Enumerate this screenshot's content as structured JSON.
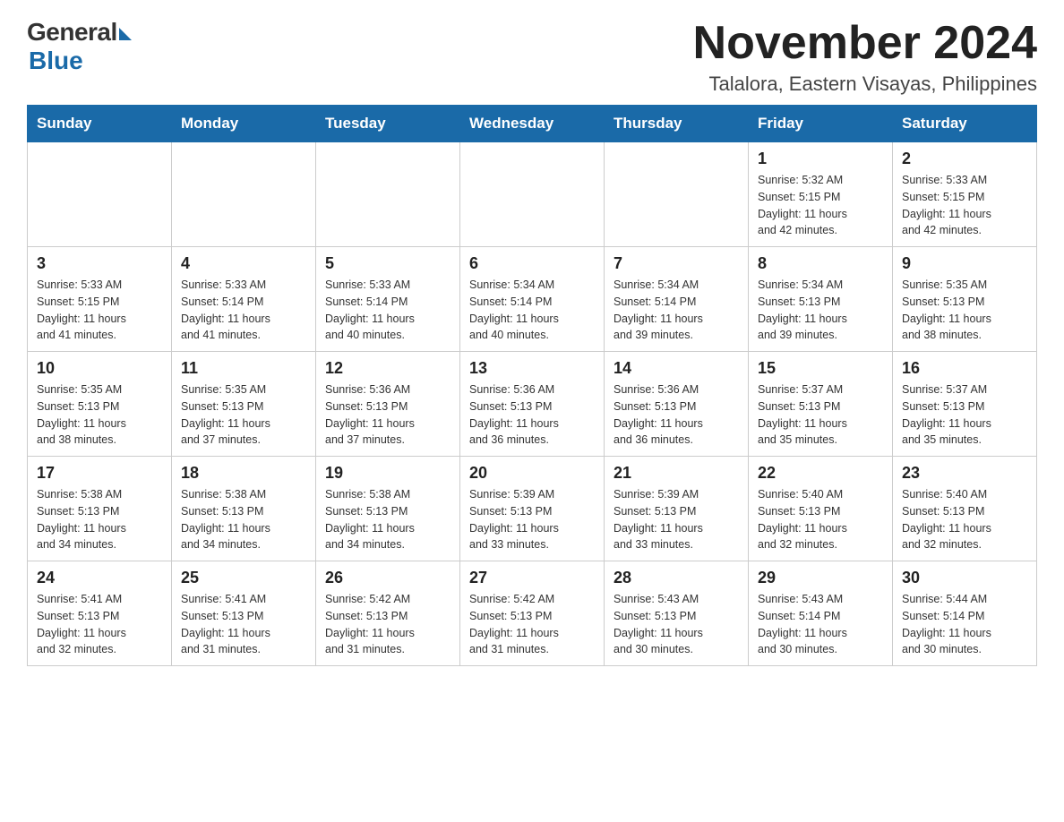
{
  "logo": {
    "general": "General",
    "blue": "Blue"
  },
  "header": {
    "month_title": "November 2024",
    "location": "Talalora, Eastern Visayas, Philippines"
  },
  "days_of_week": [
    "Sunday",
    "Monday",
    "Tuesday",
    "Wednesday",
    "Thursday",
    "Friday",
    "Saturday"
  ],
  "weeks": [
    {
      "days": [
        {
          "number": "",
          "info": ""
        },
        {
          "number": "",
          "info": ""
        },
        {
          "number": "",
          "info": ""
        },
        {
          "number": "",
          "info": ""
        },
        {
          "number": "",
          "info": ""
        },
        {
          "number": "1",
          "info": "Sunrise: 5:32 AM\nSunset: 5:15 PM\nDaylight: 11 hours\nand 42 minutes."
        },
        {
          "number": "2",
          "info": "Sunrise: 5:33 AM\nSunset: 5:15 PM\nDaylight: 11 hours\nand 42 minutes."
        }
      ]
    },
    {
      "days": [
        {
          "number": "3",
          "info": "Sunrise: 5:33 AM\nSunset: 5:15 PM\nDaylight: 11 hours\nand 41 minutes."
        },
        {
          "number": "4",
          "info": "Sunrise: 5:33 AM\nSunset: 5:14 PM\nDaylight: 11 hours\nand 41 minutes."
        },
        {
          "number": "5",
          "info": "Sunrise: 5:33 AM\nSunset: 5:14 PM\nDaylight: 11 hours\nand 40 minutes."
        },
        {
          "number": "6",
          "info": "Sunrise: 5:34 AM\nSunset: 5:14 PM\nDaylight: 11 hours\nand 40 minutes."
        },
        {
          "number": "7",
          "info": "Sunrise: 5:34 AM\nSunset: 5:14 PM\nDaylight: 11 hours\nand 39 minutes."
        },
        {
          "number": "8",
          "info": "Sunrise: 5:34 AM\nSunset: 5:13 PM\nDaylight: 11 hours\nand 39 minutes."
        },
        {
          "number": "9",
          "info": "Sunrise: 5:35 AM\nSunset: 5:13 PM\nDaylight: 11 hours\nand 38 minutes."
        }
      ]
    },
    {
      "days": [
        {
          "number": "10",
          "info": "Sunrise: 5:35 AM\nSunset: 5:13 PM\nDaylight: 11 hours\nand 38 minutes."
        },
        {
          "number": "11",
          "info": "Sunrise: 5:35 AM\nSunset: 5:13 PM\nDaylight: 11 hours\nand 37 minutes."
        },
        {
          "number": "12",
          "info": "Sunrise: 5:36 AM\nSunset: 5:13 PM\nDaylight: 11 hours\nand 37 minutes."
        },
        {
          "number": "13",
          "info": "Sunrise: 5:36 AM\nSunset: 5:13 PM\nDaylight: 11 hours\nand 36 minutes."
        },
        {
          "number": "14",
          "info": "Sunrise: 5:36 AM\nSunset: 5:13 PM\nDaylight: 11 hours\nand 36 minutes."
        },
        {
          "number": "15",
          "info": "Sunrise: 5:37 AM\nSunset: 5:13 PM\nDaylight: 11 hours\nand 35 minutes."
        },
        {
          "number": "16",
          "info": "Sunrise: 5:37 AM\nSunset: 5:13 PM\nDaylight: 11 hours\nand 35 minutes."
        }
      ]
    },
    {
      "days": [
        {
          "number": "17",
          "info": "Sunrise: 5:38 AM\nSunset: 5:13 PM\nDaylight: 11 hours\nand 34 minutes."
        },
        {
          "number": "18",
          "info": "Sunrise: 5:38 AM\nSunset: 5:13 PM\nDaylight: 11 hours\nand 34 minutes."
        },
        {
          "number": "19",
          "info": "Sunrise: 5:38 AM\nSunset: 5:13 PM\nDaylight: 11 hours\nand 34 minutes."
        },
        {
          "number": "20",
          "info": "Sunrise: 5:39 AM\nSunset: 5:13 PM\nDaylight: 11 hours\nand 33 minutes."
        },
        {
          "number": "21",
          "info": "Sunrise: 5:39 AM\nSunset: 5:13 PM\nDaylight: 11 hours\nand 33 minutes."
        },
        {
          "number": "22",
          "info": "Sunrise: 5:40 AM\nSunset: 5:13 PM\nDaylight: 11 hours\nand 32 minutes."
        },
        {
          "number": "23",
          "info": "Sunrise: 5:40 AM\nSunset: 5:13 PM\nDaylight: 11 hours\nand 32 minutes."
        }
      ]
    },
    {
      "days": [
        {
          "number": "24",
          "info": "Sunrise: 5:41 AM\nSunset: 5:13 PM\nDaylight: 11 hours\nand 32 minutes."
        },
        {
          "number": "25",
          "info": "Sunrise: 5:41 AM\nSunset: 5:13 PM\nDaylight: 11 hours\nand 31 minutes."
        },
        {
          "number": "26",
          "info": "Sunrise: 5:42 AM\nSunset: 5:13 PM\nDaylight: 11 hours\nand 31 minutes."
        },
        {
          "number": "27",
          "info": "Sunrise: 5:42 AM\nSunset: 5:13 PM\nDaylight: 11 hours\nand 31 minutes."
        },
        {
          "number": "28",
          "info": "Sunrise: 5:43 AM\nSunset: 5:13 PM\nDaylight: 11 hours\nand 30 minutes."
        },
        {
          "number": "29",
          "info": "Sunrise: 5:43 AM\nSunset: 5:14 PM\nDaylight: 11 hours\nand 30 minutes."
        },
        {
          "number": "30",
          "info": "Sunrise: 5:44 AM\nSunset: 5:14 PM\nDaylight: 11 hours\nand 30 minutes."
        }
      ]
    }
  ]
}
